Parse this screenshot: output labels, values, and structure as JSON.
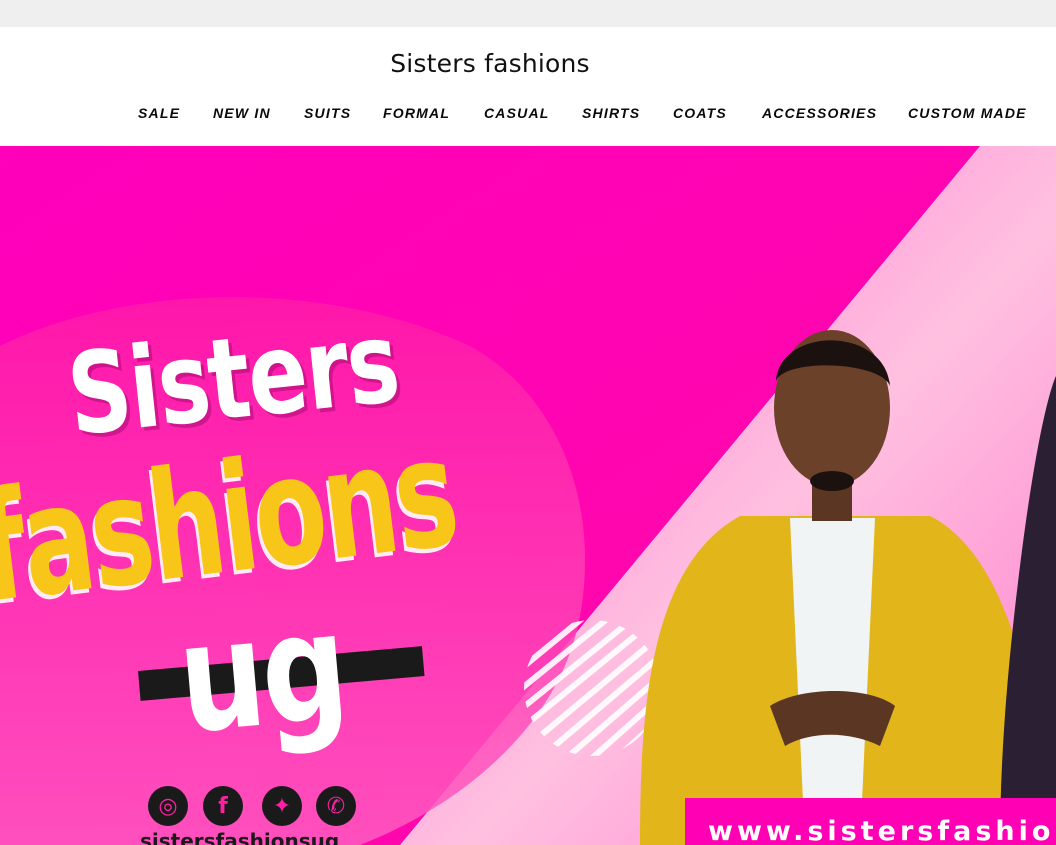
{
  "header": {
    "site_title": "Sisters fashions"
  },
  "nav": {
    "items": [
      {
        "label": "SALE"
      },
      {
        "label": "NEW IN"
      },
      {
        "label": "SUITS"
      },
      {
        "label": "FORMAL"
      },
      {
        "label": "CASUAL"
      },
      {
        "label": "SHIRTS"
      },
      {
        "label": "COATS"
      },
      {
        "label": "ACCESSORIES"
      },
      {
        "label": "CUSTOM MADE"
      }
    ]
  },
  "hero": {
    "brand_line1": "Sisters",
    "brand_line2": "fashions",
    "brand_line3": "ug",
    "social_handle": "sistersfashionsug",
    "website": "www.sistersfashio",
    "social_icons": [
      "instagram-icon",
      "facebook-icon",
      "twitter-icon",
      "whatsapp-icon"
    ],
    "colors": {
      "magenta": "#ff00b4",
      "pink_light": "#ffb3dc",
      "yellow": "#f7c619",
      "jacket": "#e0b41a"
    }
  }
}
